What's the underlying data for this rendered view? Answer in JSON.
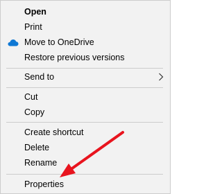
{
  "context_menu": {
    "items": [
      {
        "label": "Open",
        "bold": true
      },
      {
        "label": "Print"
      },
      {
        "label": "Move to OneDrive",
        "icon": "onedrive-cloud-icon"
      },
      {
        "label": "Restore previous versions"
      },
      {
        "label": "Send to",
        "submenu": true,
        "icon": "chevron-right-icon"
      },
      {
        "label": "Cut"
      },
      {
        "label": "Copy"
      },
      {
        "label": "Create shortcut"
      },
      {
        "label": "Delete"
      },
      {
        "label": "Rename"
      },
      {
        "label": "Properties"
      }
    ]
  },
  "colors": {
    "menu_background": "#f2f2f2",
    "separator": "#cccccc",
    "onedrive_blue": "#0f78d4",
    "annotation_arrow": "#e8141e"
  },
  "annotation": {
    "icon": "red-arrow-icon",
    "points_to": "Properties"
  }
}
